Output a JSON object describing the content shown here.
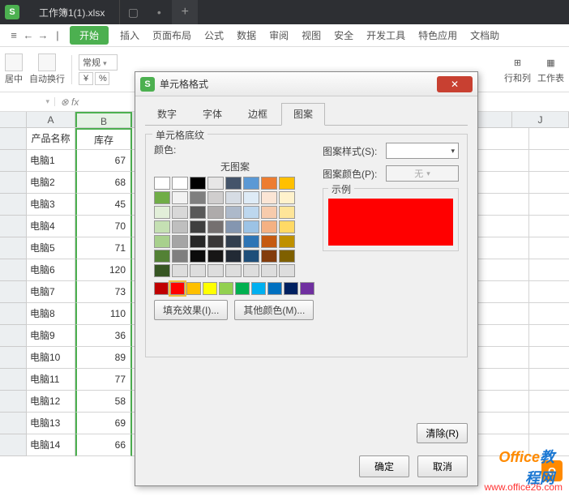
{
  "titlebar": {
    "filename": "工作簿1(1).xlsx"
  },
  "menubar": {
    "start": "开始",
    "items": [
      "插入",
      "页面布局",
      "公式",
      "数据",
      "审阅",
      "视图",
      "安全",
      "开发工具",
      "特色应用",
      "文档助"
    ]
  },
  "toolbar": {
    "center_label": "居中",
    "wrap_label": "自动换行",
    "normal_label": "常规",
    "rowcol_label": "行和列",
    "sheet_label": "工作表"
  },
  "sheet": {
    "columns": [
      "A",
      "B",
      "J"
    ],
    "headerA": "产品名称",
    "headerB": "库存",
    "rows": [
      {
        "a": "电脑1",
        "b": "67"
      },
      {
        "a": "电脑2",
        "b": "68"
      },
      {
        "a": "电脑3",
        "b": "45"
      },
      {
        "a": "电脑4",
        "b": "70"
      },
      {
        "a": "电脑5",
        "b": "71"
      },
      {
        "a": "电脑6",
        "b": "120"
      },
      {
        "a": "电脑7",
        "b": "73"
      },
      {
        "a": "电脑8",
        "b": "110"
      },
      {
        "a": "电脑9",
        "b": "36"
      },
      {
        "a": "电脑10",
        "b": "89"
      },
      {
        "a": "电脑11",
        "b": "77"
      },
      {
        "a": "电脑12",
        "b": "58"
      },
      {
        "a": "电脑13",
        "b": "69"
      },
      {
        "a": "电脑14",
        "b": "66"
      }
    ]
  },
  "dialog": {
    "title": "单元格格式",
    "tabs": [
      "数字",
      "字体",
      "边框",
      "图案"
    ],
    "activeTab": 3,
    "groupTitle": "单元格底纹",
    "colorLabel": "颜色:",
    "noPattern": "无图案",
    "fillEffects": "填充效果(I)...",
    "moreColors": "其他颜色(M)...",
    "patternStyleLabel": "图案样式(S):",
    "patternColorLabel": "图案颜色(P):",
    "patternColorValue": "无",
    "sampleTitle": "示例",
    "sampleColor": "#ff0000",
    "clear": "清除(R)",
    "ok": "确定",
    "cancel": "取消"
  },
  "palette": {
    "row1": [
      "#ffffff",
      "#000000",
      "#e7e6e6",
      "#44546a",
      "#5b99d5",
      "#ed7d31",
      "#ffc000",
      "#70ad47"
    ],
    "row1b": [
      "#4472c4",
      "#a5a5a5"
    ],
    "row2": [
      "#f2f2f2",
      "#7f7f7f",
      "#d0cece",
      "#d6dce4",
      "#deebf6",
      "#fbe5d5",
      "#fff2cc",
      "#e2efd9"
    ],
    "row3": [
      "#d8d8d8",
      "#595959",
      "#aeabab",
      "#adb9ca",
      "#bdd7ee",
      "#f7cbac",
      "#fee599",
      "#c5e0b3"
    ],
    "row4": [
      "#bfbfbf",
      "#3f3f3f",
      "#757070",
      "#8496b0",
      "#9cc3e5",
      "#f4b183",
      "#ffd965",
      "#a8d08d"
    ],
    "row5": [
      "#a5a5a5",
      "#262626",
      "#3a3838",
      "#323f4f",
      "#2e75b5",
      "#c55a11",
      "#bf9000",
      "#538135"
    ],
    "row6": [
      "#7f7f7f",
      "#0c0c0c",
      "#171616",
      "#222a35",
      "#1e4e79",
      "#833c0b",
      "#7f6000",
      "#375623"
    ],
    "std": [
      "#c00000",
      "#ff0000",
      "#ffc000",
      "#ffff00",
      "#92d050",
      "#00b050",
      "#00b0f0",
      "#0070c0",
      "#002060",
      "#7030a0"
    ]
  },
  "watermark": {
    "line1a": "Office",
    "line1b": "教程网",
    "url": "www.office26.com"
  }
}
